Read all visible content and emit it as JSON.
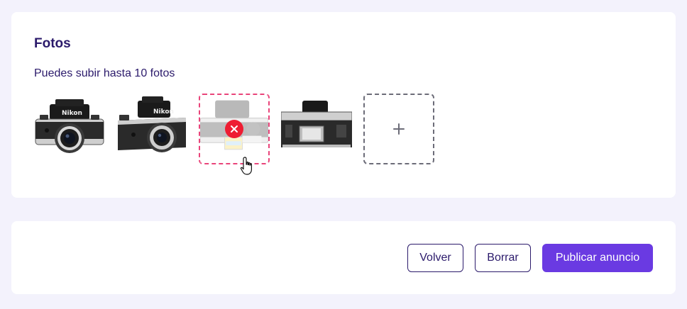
{
  "photos_section": {
    "title": "Fotos",
    "hint": "Puedes subir hasta 10 fotos",
    "photos": [
      {
        "alt": "Nikon camera front view",
        "brand_text": "Nikon"
      },
      {
        "alt": "Nikon camera angled view",
        "brand_text": "Nikon"
      },
      {
        "alt": "Camera with price sticker",
        "brand_text": ""
      },
      {
        "alt": "Camera body without lens",
        "brand_text": ""
      }
    ],
    "selected_photo_index": 2,
    "remove_icon": "close-icon",
    "add_icon": "plus-icon",
    "colors": {
      "title": "#2b1a6b",
      "selected_border": "#e9447a",
      "remove_bg": "#ee1d32",
      "add_border": "#6c6c78"
    }
  },
  "actions": {
    "back_label": "Volver",
    "clear_label": "Borrar",
    "publish_label": "Publicar anuncio",
    "colors": {
      "primary": "#6a3ae2",
      "outline": "#2b1a6b"
    }
  }
}
